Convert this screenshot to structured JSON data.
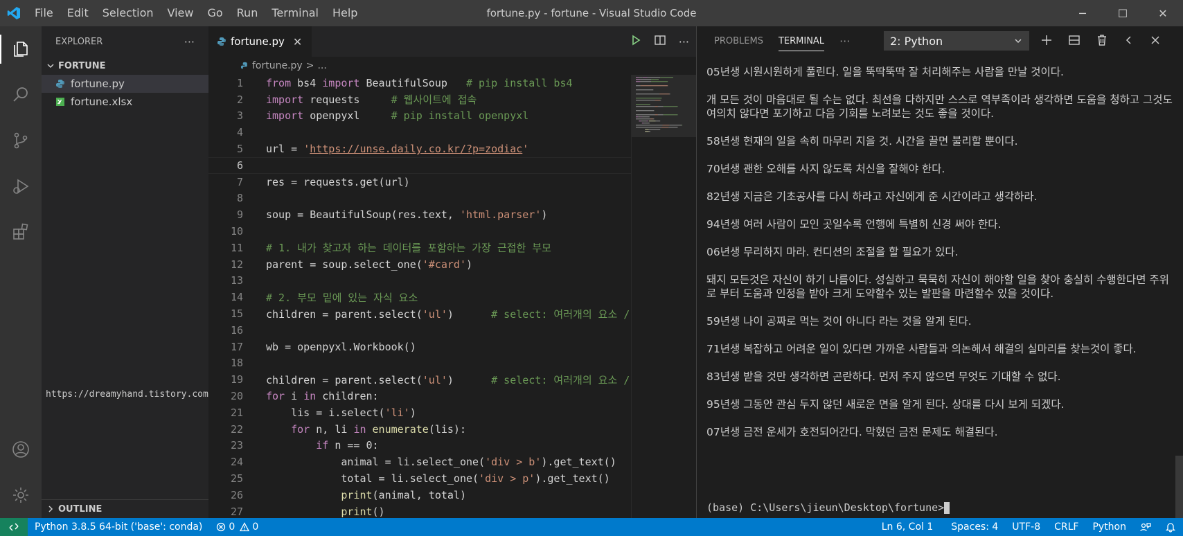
{
  "window": {
    "title": "fortune.py - fortune - Visual Studio Code",
    "menu": [
      "File",
      "Edit",
      "Selection",
      "View",
      "Go",
      "Run",
      "Terminal",
      "Help"
    ],
    "controls": {
      "minimize": "─",
      "maximize": "☐",
      "close": "✕"
    }
  },
  "sidebar": {
    "header": "EXPLORER",
    "more": "···",
    "folder": "FORTUNE",
    "files": [
      {
        "name": "fortune.py",
        "icon": "python-file-icon"
      },
      {
        "name": "fortune.xlsx",
        "icon": "excel-file-icon"
      }
    ],
    "url_text": "https://dreamyhand.tistory.com/",
    "outline": "OUTLINE"
  },
  "editor": {
    "tab": "fortune.py",
    "tab_close": "✕",
    "more": "···",
    "breadcrumb": {
      "file": "fortune.py",
      "sep": ">",
      "rest": "..."
    }
  },
  "code_lines": [
    {
      "n": "1",
      "parts": [
        [
          "kw",
          "from"
        ],
        [
          "src",
          " bs4 "
        ],
        [
          "kw",
          "import"
        ],
        [
          "src",
          " BeautifulSoup   "
        ],
        [
          "cm",
          "# pip install bs4"
        ]
      ]
    },
    {
      "n": "2",
      "parts": [
        [
          "kw",
          "import"
        ],
        [
          "src",
          " requests     "
        ],
        [
          "cm",
          "# 웹사이트에 접속"
        ]
      ]
    },
    {
      "n": "3",
      "parts": [
        [
          "kw",
          "import"
        ],
        [
          "src",
          " openpyxl     "
        ],
        [
          "cm",
          "# pip install openpyxl"
        ]
      ]
    },
    {
      "n": "4",
      "parts": []
    },
    {
      "n": "5",
      "parts": [
        [
          "src",
          "url = "
        ],
        [
          "st",
          "'"
        ],
        [
          "url",
          "https://unse.daily.co.kr/?p=zodiac"
        ],
        [
          "st",
          "'"
        ]
      ]
    },
    {
      "n": "6",
      "parts": [],
      "current": true
    },
    {
      "n": "7",
      "parts": [
        [
          "src",
          "res = requests.get(url)"
        ]
      ]
    },
    {
      "n": "8",
      "parts": []
    },
    {
      "n": "9",
      "parts": [
        [
          "src",
          "soup = BeautifulSoup(res.text, "
        ],
        [
          "st",
          "'html.parser'"
        ],
        [
          "src",
          ")"
        ]
      ]
    },
    {
      "n": "10",
      "parts": []
    },
    {
      "n": "11",
      "parts": [
        [
          "cm",
          "# 1. 내가 찾고자 하는 데이터를 포함하는 가장 근접한 부모"
        ]
      ]
    },
    {
      "n": "12",
      "parts": [
        [
          "src",
          "parent = soup.select_one("
        ],
        [
          "st",
          "'#card'"
        ],
        [
          "src",
          ")"
        ]
      ]
    },
    {
      "n": "13",
      "parts": []
    },
    {
      "n": "14",
      "parts": [
        [
          "cm",
          "# 2. 부모 밑에 있는 자식 요소"
        ]
      ]
    },
    {
      "n": "15",
      "parts": [
        [
          "src",
          "children = parent.select("
        ],
        [
          "st",
          "'ul'"
        ],
        [
          "src",
          ")      "
        ],
        [
          "cm",
          "# select: 여러개의 요소 /"
        ]
      ]
    },
    {
      "n": "16",
      "parts": []
    },
    {
      "n": "17",
      "parts": [
        [
          "src",
          "wb = openpyxl.Workbook()"
        ]
      ]
    },
    {
      "n": "18",
      "parts": []
    },
    {
      "n": "19",
      "parts": [
        [
          "src",
          "children = parent.select("
        ],
        [
          "st",
          "'ul'"
        ],
        [
          "src",
          ")      "
        ],
        [
          "cm",
          "# select: 여러개의 요소 /"
        ]
      ]
    },
    {
      "n": "20",
      "parts": [
        [
          "kw",
          "for"
        ],
        [
          "src",
          " i "
        ],
        [
          "kw",
          "in"
        ],
        [
          "src",
          " children:"
        ]
      ]
    },
    {
      "n": "21",
      "parts": [
        [
          "src",
          "    lis = i.select("
        ],
        [
          "st",
          "'li'"
        ],
        [
          "src",
          ")"
        ]
      ]
    },
    {
      "n": "22",
      "parts": [
        [
          "src",
          "    "
        ],
        [
          "kw",
          "for"
        ],
        [
          "src",
          " n, li "
        ],
        [
          "kw",
          "in"
        ],
        [
          "src",
          " "
        ],
        [
          "fn",
          "enumerate"
        ],
        [
          "src",
          "(lis):"
        ]
      ]
    },
    {
      "n": "23",
      "parts": [
        [
          "src",
          "        "
        ],
        [
          "kw",
          "if"
        ],
        [
          "src",
          " n == 0:"
        ]
      ]
    },
    {
      "n": "24",
      "parts": [
        [
          "src",
          "            animal = li.select_one("
        ],
        [
          "st",
          "'div > b'"
        ],
        [
          "src",
          ").get_text()    "
        ],
        [
          "cm",
          "#"
        ]
      ]
    },
    {
      "n": "25",
      "parts": [
        [
          "src",
          "            total = li.select_one("
        ],
        [
          "st",
          "'div > p'"
        ],
        [
          "src",
          ").get_text()"
        ]
      ]
    },
    {
      "n": "26",
      "parts": [
        [
          "src",
          "            "
        ],
        [
          "fn",
          "print"
        ],
        [
          "src",
          "(animal, total)"
        ]
      ]
    },
    {
      "n": "27",
      "parts": [
        [
          "src",
          "            "
        ],
        [
          "fn",
          "print"
        ],
        [
          "src",
          "()"
        ]
      ]
    }
  ],
  "panel": {
    "tabs": [
      "PROBLEMS",
      "TERMINAL"
    ],
    "more": "···",
    "terminal_select": "2: Python",
    "terminal_lines": [
      "05년생 시원시원하게 풀린다. 일을 뚝딱뚝딱 잘 처리해주는 사람을 만날 것이다.",
      "개 모든 것이 마음대로 될 수는 없다. 최선을 다하지만 스스로 역부족이라 생각하면 도움을 청하고 그것도 여의치 않다면 포기하고 다음 기회를 노려보는 것도 좋을 것이다.",
      "58년생 현재의 일을 속히 마무리 지을 것. 시간을 끌면 불리할 뿐이다.",
      "70년생 괜한 오해를 사지 않도록 처신을 잘해야 한다.",
      "82년생 지금은 기초공사를 다시 하라고 자신에게 준 시간이라고 생각하라.",
      "94년생 여러 사람이 모인 곳일수록 언행에 특별히 신경 써야 한다.",
      "06년생 무리하지 마라. 컨디션의 조절을 할 필요가 있다.",
      "돼지 모든것은 자신이 하기 나름이다. 성실하고 묵묵히 자신이 해야할 일을 찾아 충실히 수행한다면 주위로 부터 도움과 인정을 받아 크게 도약할수 있는 발판을 마련할수 있을 것이다.",
      "59년생 나이 공짜로 먹는 것이 아니다 라는 것을 알게 된다.",
      "71년생 복잡하고 어려운 일이 있다면 가까운 사람들과 의논해서 해결의 실마리를 찾는것이 좋다.",
      "83년생 받을 것만 생각하면 곤란하다. 먼저 주지 않으면 무엇도 기대할 수 없다.",
      "95년생 그동안 관심 두지 않던 새로운 면을 알게 된다. 상대를 다시 보게 되겠다.",
      "07년생 금전 운세가 호전되어간다. 막혔던 금전 문제도 해결된다."
    ],
    "prompt": "(base) C:\\Users\\jieun\\Desktop\\fortune>"
  },
  "status": {
    "python": "Python 3.8.5 64-bit ('base': conda)",
    "errors": "0",
    "warnings": "0",
    "position": "Ln 6, Col 1",
    "spaces": "Spaces: 4",
    "encoding": "UTF-8",
    "eol": "CRLF",
    "language": "Python"
  },
  "colors": {
    "accent": "#007acc",
    "remote": "#16825d",
    "activity": "#333333",
    "sidebar": "#252526"
  }
}
